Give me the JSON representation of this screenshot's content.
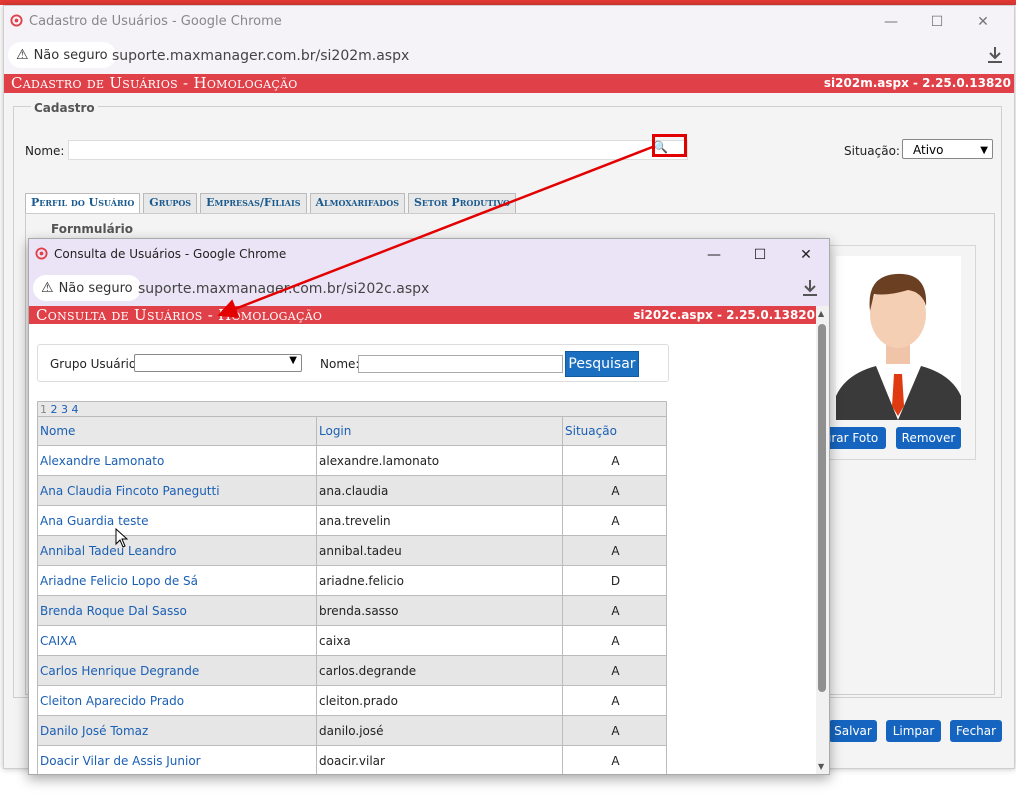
{
  "main_window": {
    "title": "Cadastro de Usuários - Google Chrome",
    "not_secure": "Não seguro",
    "url": "suporte.maxmanager.com.br/si202m.aspx",
    "header_title": "Cadastro de Usuários  - Homologação",
    "header_version": "si202m.aspx - 2.25.0.13820",
    "fieldset_legend": "Cadastro",
    "nome_label": "Nome:",
    "situacao_label": "Situação:",
    "situacao_value": "Ativo",
    "tabs": [
      "Perfil do Usuário",
      "Grupos",
      "Empresas/Filiais",
      "Almoxarifados",
      "Setor Produtivo"
    ],
    "form_legend": "Fornmulário",
    "btn_procurar_foto": "urar Foto",
    "btn_remover": "Remover",
    "btn_salvar": "Salvar",
    "btn_limpar": "Limpar",
    "btn_fechar": "Fechar"
  },
  "popup": {
    "title": "Consulta de Usuários - Google Chrome",
    "not_secure": "Não seguro",
    "url": "suporte.maxmanager.com.br/si202c.aspx",
    "header_title": "Consulta de Usuários  - Homologação",
    "header_version": "si202c.aspx - 2.25.0.13820",
    "grupo_label": "Grupo Usuário:",
    "nome_label": "Nome:",
    "pesquisar_button": "Pesquisar",
    "pager": [
      "1",
      "2",
      "3",
      "4"
    ],
    "columns": [
      "Nome",
      "Login",
      "Situação"
    ],
    "rows": [
      {
        "nome": "Alexandre Lamonato",
        "login": "alexandre.lamonato",
        "situacao": "A"
      },
      {
        "nome": "Ana Claudia Fincoto Panegutti",
        "login": "ana.claudia",
        "situacao": "A"
      },
      {
        "nome": "Ana Guardia teste",
        "login": "ana.trevelin",
        "situacao": "A"
      },
      {
        "nome": "Annibal Tadeu Leandro",
        "login": "annibal.tadeu",
        "situacao": "A"
      },
      {
        "nome": "Ariadne Felicio Lopo de Sá",
        "login": "ariadne.felicio",
        "situacao": "D"
      },
      {
        "nome": "Brenda Roque Dal Sasso",
        "login": "brenda.sasso",
        "situacao": "A"
      },
      {
        "nome": "CAIXA",
        "login": "caixa",
        "situacao": "A"
      },
      {
        "nome": "Carlos Henrique Degrande",
        "login": "carlos.degrande",
        "situacao": "A"
      },
      {
        "nome": "Cleiton Aparecido Prado",
        "login": "cleiton.prado",
        "situacao": "A"
      },
      {
        "nome": "Danilo José Tomaz",
        "login": "danilo.josé",
        "situacao": "A"
      },
      {
        "nome": "Doacir Vilar de Assis Junior",
        "login": "doacir.vilar",
        "situacao": "A"
      }
    ]
  },
  "colors": {
    "header_red": "#e04048",
    "link_blue": "#1a5fb4",
    "button_blue": "#1565c0",
    "annotation_red": "#e30000"
  }
}
